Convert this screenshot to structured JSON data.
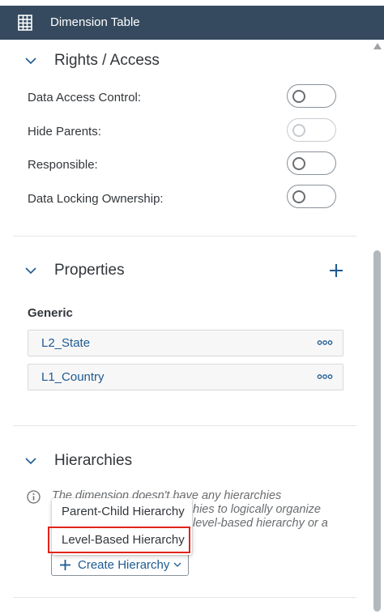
{
  "header": {
    "title": "Dimension Table",
    "icon": "table-icon",
    "background": "#354a5f"
  },
  "rights_access": {
    "title": "Rights / Access",
    "rows": [
      {
        "label": "Data Access Control:",
        "on": false,
        "disabled": false
      },
      {
        "label": "Hide Parents:",
        "on": false,
        "disabled": true
      },
      {
        "label": "Responsible:",
        "on": false,
        "disabled": false
      },
      {
        "label": "Data Locking Ownership:",
        "on": false,
        "disabled": false
      }
    ]
  },
  "properties": {
    "title": "Properties",
    "add_icon": "plus-icon",
    "group_label": "Generic",
    "items": [
      {
        "name": "L2_State",
        "more_icon": "overflow-icon"
      },
      {
        "name": "L1_Country",
        "more_icon": "overflow-icon"
      }
    ]
  },
  "hierarchies": {
    "title": "Hierarchies",
    "info_icon": "info-icon",
    "info_lines": [
      "The dimension doesn't have any hierarchies",
      "hies to logically organize",
      "level-based hierarchy or a"
    ],
    "create_button": {
      "label": "Create Hierarchy",
      "icon": "plus-icon",
      "caret": "chevron-down-icon"
    },
    "menu": [
      {
        "label": "Parent-Child Hierarchy",
        "highlighted": false
      },
      {
        "label": "Level-Based Hierarchy",
        "highlighted": true
      }
    ]
  },
  "colors": {
    "accent": "#1d5a91",
    "highlight_border": "#e2231a"
  }
}
